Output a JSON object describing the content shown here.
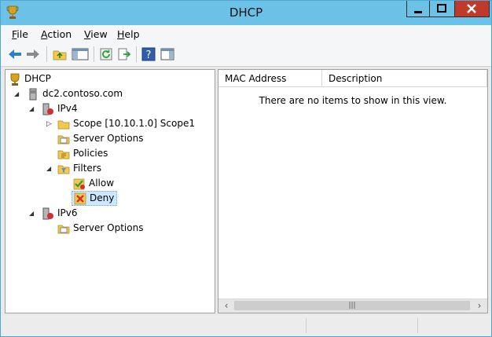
{
  "window": {
    "title": "DHCP"
  },
  "menu": [
    {
      "label": "File",
      "accel": "F",
      "rest": "ile"
    },
    {
      "label": "Action",
      "accel": "A",
      "rest": "ction"
    },
    {
      "label": "View",
      "accel": "V",
      "rest": "iew"
    },
    {
      "label": "Help",
      "accel": "H",
      "rest": "elp"
    }
  ],
  "tree": {
    "root": "DHCP",
    "server": "dc2.contoso.com",
    "ipv4": "IPv4",
    "scope": "Scope [10.10.1.0] Scope1",
    "ipv4_server_options": "Server Options",
    "policies": "Policies",
    "filters": "Filters",
    "allow": "Allow",
    "deny": "Deny",
    "ipv6": "IPv6",
    "ipv6_server_options": "Server Options"
  },
  "list": {
    "columns": [
      "MAC Address",
      "Description"
    ],
    "empty_message": "There are no items to show in this view."
  },
  "icons": {
    "app": "dhcp-trophy-icon",
    "back": "back-arrow-icon",
    "forward": "forward-arrow-icon",
    "up": "up-folder-icon",
    "show_hide_tree": "show-hide-console-tree-icon",
    "refresh": "refresh-icon",
    "export": "export-list-icon",
    "help": "help-icon",
    "action_pane": "show-action-pane-icon"
  },
  "colors": {
    "titlebar": "#6cc2e6",
    "close_button": "#c0392b",
    "selection": "#cce8ff",
    "deny_x": "#d32f2f",
    "allow_check": "#2e9d3a",
    "folder": "#f2c94c"
  }
}
